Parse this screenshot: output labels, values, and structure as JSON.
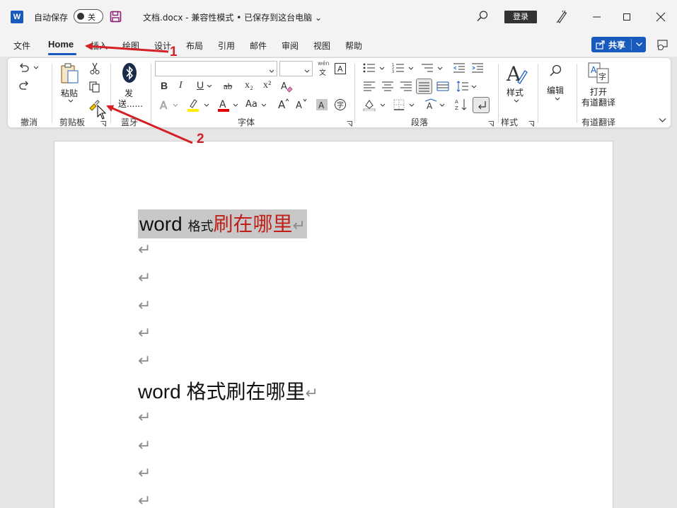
{
  "titlebar": {
    "app_icon_letter": "W",
    "autosave_label": "自动保存",
    "autosave_state": "关",
    "document_title": "文档.docx  -  兼容性模式 • 已保存到这台电脑 ⌄",
    "login_label": "登录"
  },
  "tabs": [
    {
      "label": "文件"
    },
    {
      "label": "Home"
    },
    {
      "label": "插入"
    },
    {
      "label": "绘图"
    },
    {
      "label": "设计"
    },
    {
      "label": "布局"
    },
    {
      "label": "引用"
    },
    {
      "label": "邮件"
    },
    {
      "label": "审阅"
    },
    {
      "label": "视图"
    },
    {
      "label": "帮助"
    }
  ],
  "active_tab": "Home",
  "share_label": "共享",
  "ribbon": {
    "undo_group": "撤消",
    "clipboard": {
      "paste_label": "粘贴",
      "group_label": "剪贴板"
    },
    "bluetooth": {
      "send_label_1": "发",
      "send_label_2": "送......",
      "group_label": "蓝牙"
    },
    "font": {
      "group_label": "字体",
      "font_name": "",
      "font_size": "",
      "bold": "B",
      "italic": "I",
      "underline": "U",
      "strike": "ab",
      "subscript": "x₂",
      "superscript": "x²",
      "case_label": "Aa",
      "phonetic_top": "wén",
      "phonetic_bottom": "文"
    },
    "paragraph": {
      "group_label": "段落"
    },
    "styles": {
      "label": "样式",
      "group_label": "样式"
    },
    "editing": {
      "label": "编辑"
    },
    "youdao": {
      "label_1": "打开",
      "label_2": "有道翻译",
      "group_label": "有道翻译"
    }
  },
  "document": {
    "line1": {
      "part1": "word ",
      "part2": "格式",
      "part3": "刷在哪里"
    },
    "line2": {
      "part1": "word ",
      "part2": "格式刷在哪里"
    },
    "paragraph_mark": "↵"
  },
  "annotations": [
    {
      "number": "1",
      "color": "#d42027"
    },
    {
      "number": "2",
      "color": "#d42027"
    }
  ]
}
